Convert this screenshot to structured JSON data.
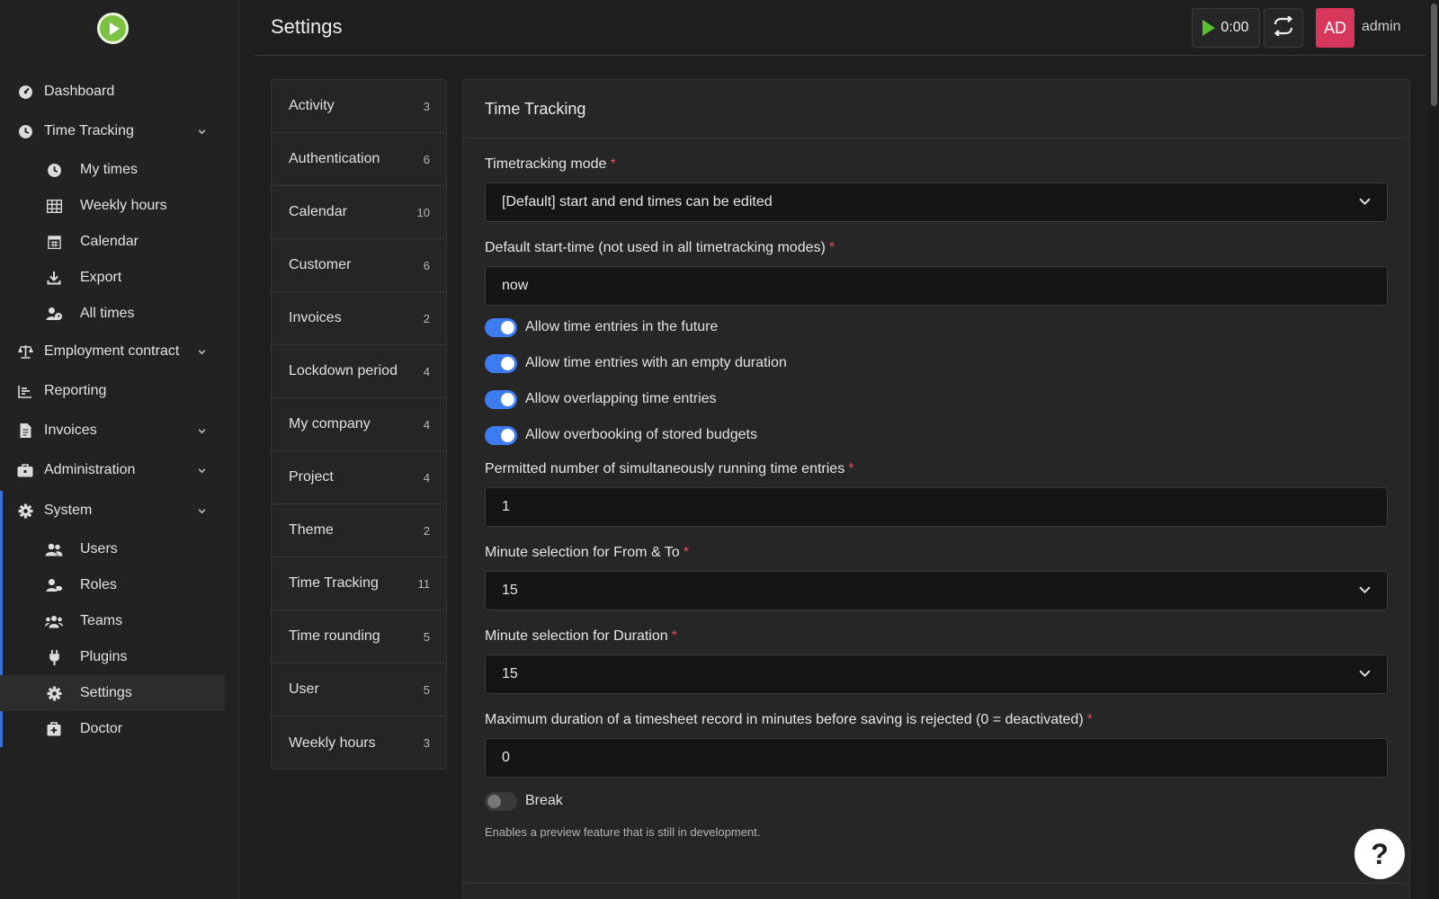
{
  "header": {
    "title": "Settings",
    "timer": "0:00",
    "avatar_initials": "AD",
    "username": "admin"
  },
  "sidebar": {
    "dashboard": "Dashboard",
    "time_tracking": "Time Tracking",
    "my_times": "My times",
    "weekly_hours": "Weekly hours",
    "calendar": "Calendar",
    "export": "Export",
    "all_times": "All times",
    "employment_contract": "Employment contract",
    "reporting": "Reporting",
    "invoices": "Invoices",
    "administration": "Administration",
    "system": "System",
    "users": "Users",
    "roles": "Roles",
    "teams": "Teams",
    "plugins": "Plugins",
    "settings": "Settings",
    "doctor": "Doctor"
  },
  "categories": [
    {
      "label": "Activity",
      "count": "3"
    },
    {
      "label": "Authentication",
      "count": "6"
    },
    {
      "label": "Calendar",
      "count": "10"
    },
    {
      "label": "Customer",
      "count": "6"
    },
    {
      "label": "Invoices",
      "count": "2"
    },
    {
      "label": "Lockdown period",
      "count": "4"
    },
    {
      "label": "My company",
      "count": "4"
    },
    {
      "label": "Project",
      "count": "4"
    },
    {
      "label": "Theme",
      "count": "2"
    },
    {
      "label": "Time Tracking",
      "count": "11"
    },
    {
      "label": "Time rounding",
      "count": "5"
    },
    {
      "label": "User",
      "count": "5"
    },
    {
      "label": "Weekly hours",
      "count": "3"
    }
  ],
  "panel": {
    "title": "Time Tracking",
    "mode_label": "Timetracking mode",
    "mode_value": "[Default] start and end times can be edited",
    "start_label": "Default start-time (not used in all timetracking modes)",
    "start_value": "now",
    "toggle_future": "Allow time entries in the future",
    "toggle_empty": "Allow time entries with an empty duration",
    "toggle_overlap": "Allow overlapping time entries",
    "toggle_overbook": "Allow overbooking of stored budgets",
    "running_label": "Permitted number of simultaneously running time entries",
    "running_value": "1",
    "from_to_label": "Minute selection for From & To",
    "from_to_value": "15",
    "duration_label": "Minute selection for Duration",
    "duration_value": "15",
    "max_label": "Maximum duration of a timesheet record in minutes before saving is rejected (0 = deactivated)",
    "max_value": "0",
    "break_label": "Break",
    "break_help": "Enables a preview feature that is still in development.",
    "required_mark": "*"
  },
  "toggles": {
    "future": true,
    "empty": true,
    "overlap": true,
    "overbook": true,
    "break": false
  },
  "colors": {
    "accent": "#3d7cf0",
    "avatar": "#d8375c",
    "logo": "#7bc142",
    "required": "#e05050"
  }
}
